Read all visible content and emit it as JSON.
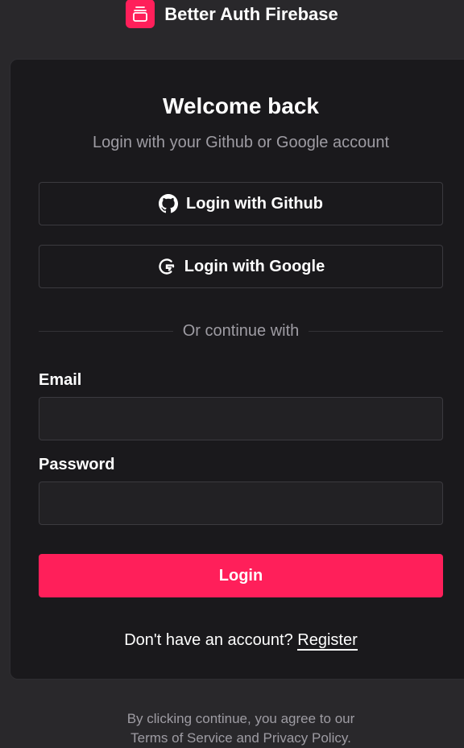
{
  "brand": {
    "name": "Better Auth Firebase",
    "logo_icon": "stacked-layers-icon",
    "accent": "#ff1f5a"
  },
  "card": {
    "title": "Welcome back",
    "subtitle": "Login with your Github or Google account"
  },
  "social": {
    "github_label": "Login with Github",
    "github_icon": "github-icon",
    "google_label": "Login with Google",
    "google_icon": "google-icon"
  },
  "divider": {
    "text": "Or continue with"
  },
  "form": {
    "email_label": "Email",
    "email_value": "",
    "password_label": "Password",
    "password_value": "",
    "submit_label": "Login"
  },
  "register": {
    "prompt": "Don't have an account?",
    "link_label": "Register"
  },
  "footer": {
    "line1": "By clicking continue, you agree to our",
    "line2": "Terms of Service and Privacy Policy."
  },
  "colors": {
    "background": "#29282b",
    "card": "#1a191c",
    "muted_text": "#9e9ca3",
    "primary": "#ff1f5a"
  }
}
